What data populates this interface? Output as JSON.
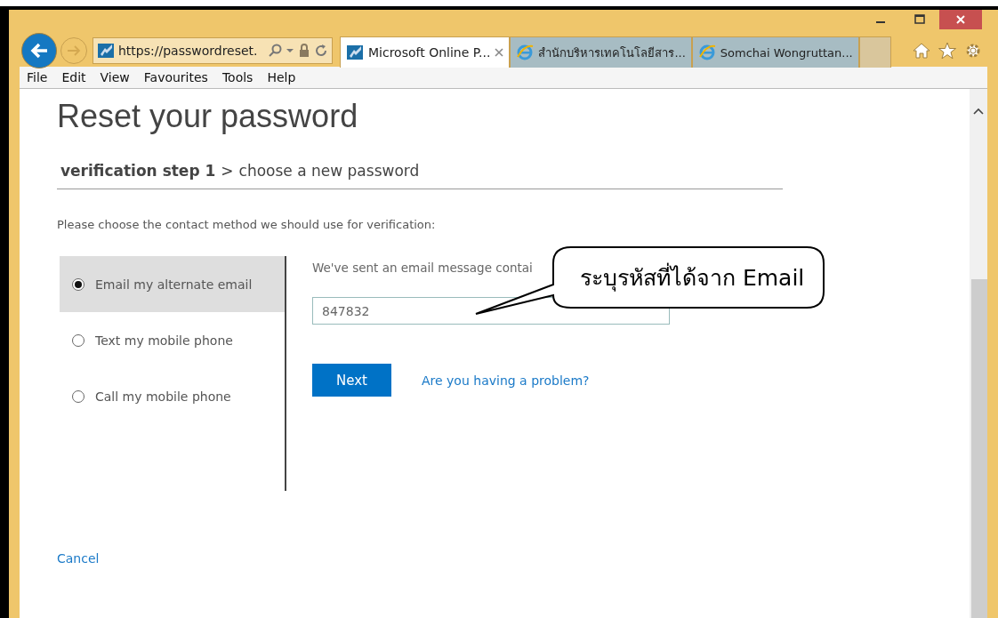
{
  "browser": {
    "url": "https://passwordreset.",
    "tabs": [
      {
        "title": "Microsoft Online P...",
        "selected": true,
        "closable": true
      },
      {
        "title": "สำนักบริหารเทคโนโลยีสาร...",
        "selected": false,
        "closable": false
      },
      {
        "title": "Somchai Wongruttan...",
        "selected": false,
        "closable": false
      }
    ],
    "menu": [
      "File",
      "Edit",
      "View",
      "Favourites",
      "Tools",
      "Help"
    ]
  },
  "page": {
    "title": "Reset your password",
    "steps": [
      {
        "label": "verification step 1",
        "current": true
      },
      {
        "label": "choose a new password",
        "current": false
      }
    ],
    "step_separator": ">",
    "prompt": "Please choose the contact method we should use for verification:",
    "methods": [
      {
        "label": "Email my alternate email",
        "selected": true
      },
      {
        "label": "Text my mobile phone",
        "selected": false
      },
      {
        "label": "Call my mobile phone",
        "selected": false
      }
    ],
    "message": "We've sent an email message contai",
    "code_field": {
      "value": "847832"
    },
    "next_button": "Next",
    "help_link": "Are you having a problem?",
    "cancel_link": "Cancel"
  },
  "callout": {
    "text": "ระบุรหัสที่ได้จาก Email"
  }
}
